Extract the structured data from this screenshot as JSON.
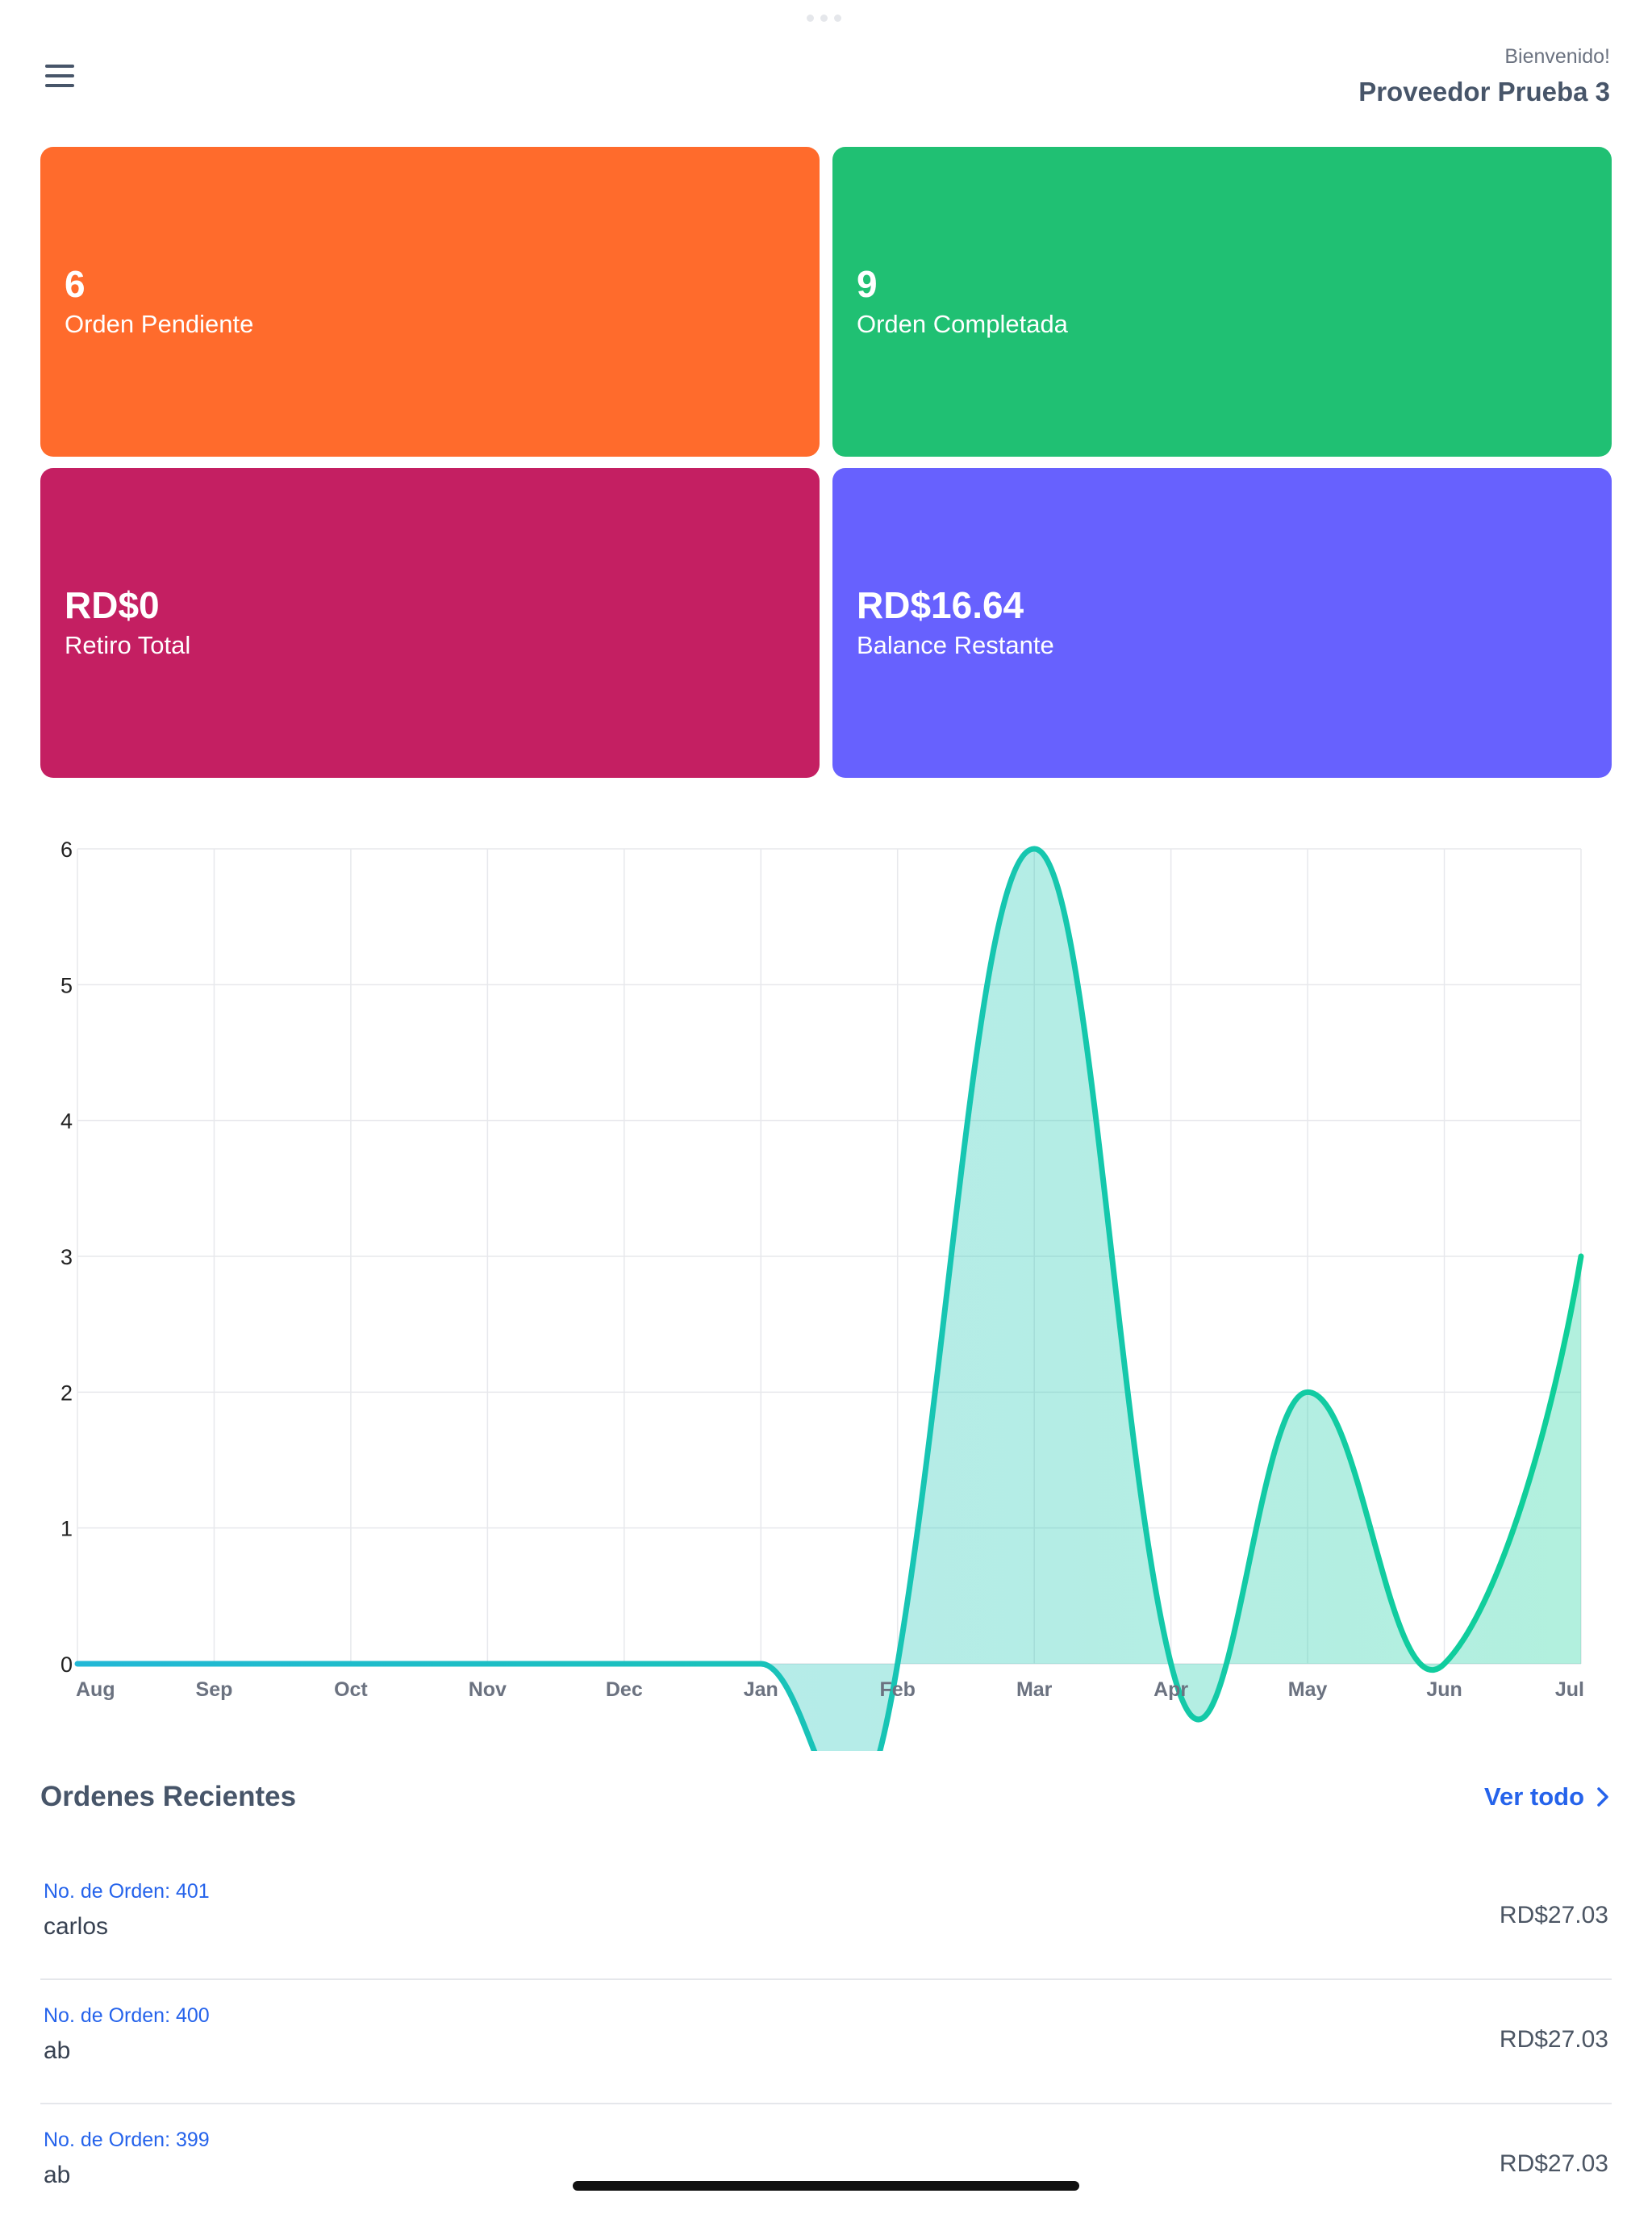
{
  "header": {
    "menu_icon": "hamburger-menu-icon",
    "greeting": "Bienvenido!",
    "user_name": "Proveedor Prueba 3"
  },
  "stats": [
    {
      "value": "6",
      "label": "Orden Pendiente",
      "color": "#ff6b2c"
    },
    {
      "value": "9",
      "label": "Orden Completada",
      "color": "#20c073"
    },
    {
      "value": "RD$0",
      "label": "Retiro Total",
      "color": "#c41f62"
    },
    {
      "value": "RD$16.64",
      "label": "Balance Restante",
      "color": "#6761fe"
    }
  ],
  "chart_data": {
    "type": "area",
    "categories": [
      "Aug",
      "Sep",
      "Oct",
      "Nov",
      "Dec",
      "Jan",
      "Feb",
      "Mar",
      "Apr",
      "May",
      "Jun",
      "Jul"
    ],
    "series": [
      {
        "values": [
          0,
          0,
          0,
          0,
          0,
          0,
          0,
          6,
          0,
          2,
          0,
          3
        ]
      }
    ],
    "y_ticks": [
      "0",
      "1",
      "2",
      "3",
      "4",
      "5",
      "6"
    ],
    "ylim": [
      0,
      6
    ],
    "curve": "smooth",
    "grid": true,
    "line_color_start": "#22b8d6",
    "line_color_end": "#0fcf98"
  },
  "recent_orders": {
    "title": "Ordenes Recientes",
    "view_all": "Ver todo",
    "items": [
      {
        "number": "No. de Orden: 401",
        "customer": "carlos",
        "amount": "RD$27.03"
      },
      {
        "number": "No. de Orden: 400",
        "customer": "ab",
        "amount": "RD$27.03"
      },
      {
        "number": "No. de Orden: 399",
        "customer": "ab",
        "amount": "RD$27.03"
      }
    ]
  }
}
